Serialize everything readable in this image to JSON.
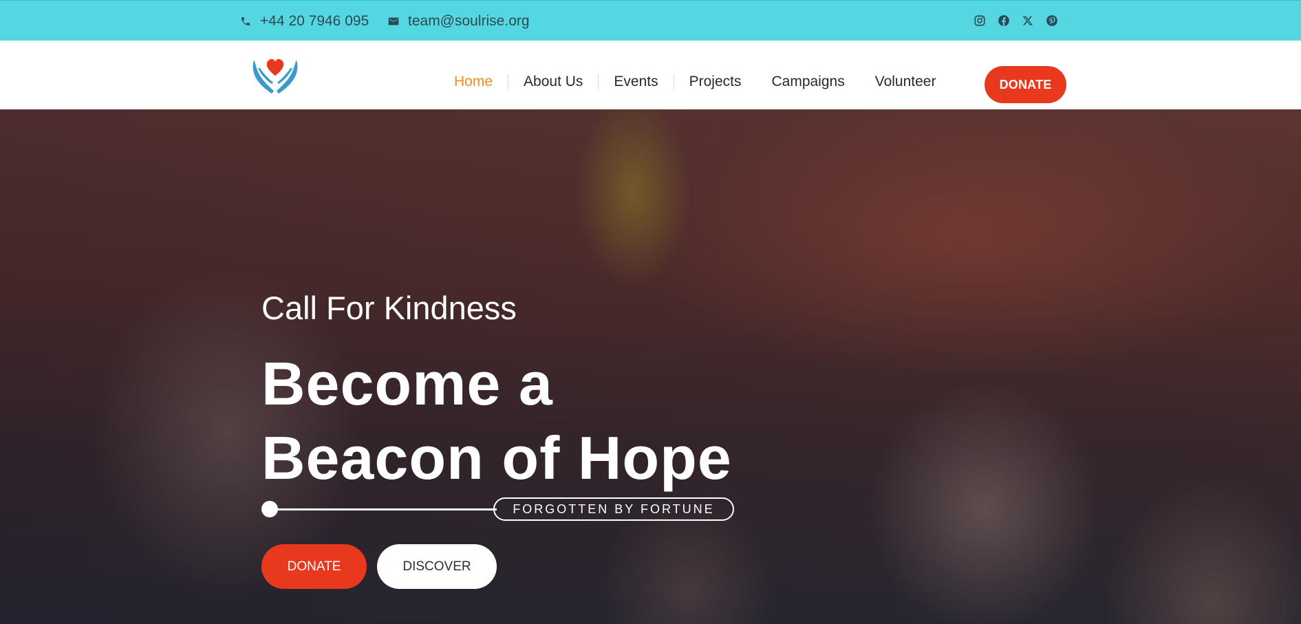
{
  "topbar": {
    "phone": "+44 20 7946 095",
    "email": "team@soulrise.org",
    "phone_icon": "phone-icon",
    "email_icon": "mail-icon",
    "socials": [
      "instagram-icon",
      "facebook-icon",
      "x-icon",
      "pinterest-icon"
    ]
  },
  "nav": {
    "logo_icon": "heart-hands-logo",
    "items": [
      {
        "label": "Home",
        "active": true
      },
      {
        "label": "About Us"
      },
      {
        "label": "Events"
      },
      {
        "label": "Projects"
      },
      {
        "label": "Campaigns"
      },
      {
        "label": "Volunteer"
      }
    ],
    "donate_label": "DONATE"
  },
  "hero": {
    "eyebrow": "Call For Kindness",
    "headline_line1": "Become a",
    "headline_line2": "Beacon of Hope",
    "tagline": "FORGOTTEN BY FORTUNE",
    "donate_label": "DONATE",
    "discover_label": "DISCOVER"
  },
  "colors": {
    "topbar": "#55d7e1",
    "accent": "#e8391f",
    "active_nav": "#f08a1c"
  }
}
